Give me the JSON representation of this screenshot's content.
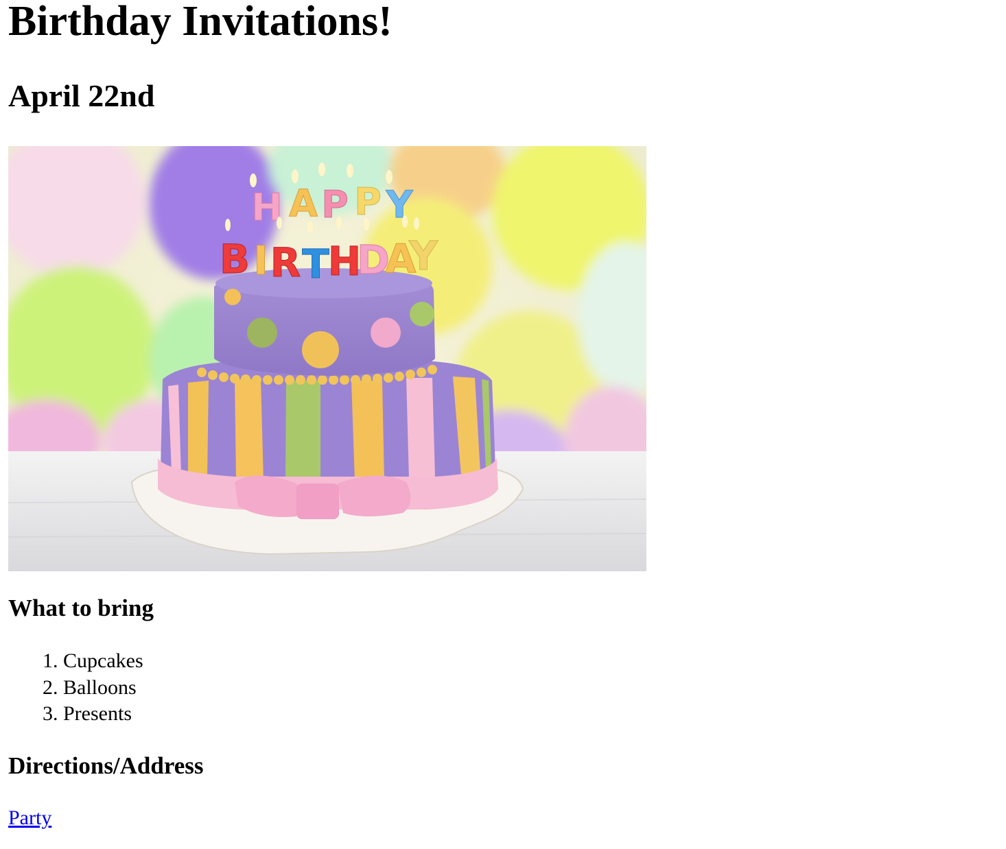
{
  "page": {
    "title": "Birthday Invitations!",
    "date": "April 22nd"
  },
  "hero_image": {
    "icon": "birthday-cake-image",
    "candle_letters_top": "HAPPY",
    "candle_letters_bottom": "BIRTHDAY"
  },
  "bring": {
    "heading": "What to bring",
    "items": [
      "Cupcakes",
      "Balloons",
      "Presents"
    ]
  },
  "directions": {
    "heading": "Directions/Address",
    "link_label": "Party"
  },
  "colors": {
    "link": "#0000ee",
    "text": "#000000",
    "background": "#ffffff"
  }
}
